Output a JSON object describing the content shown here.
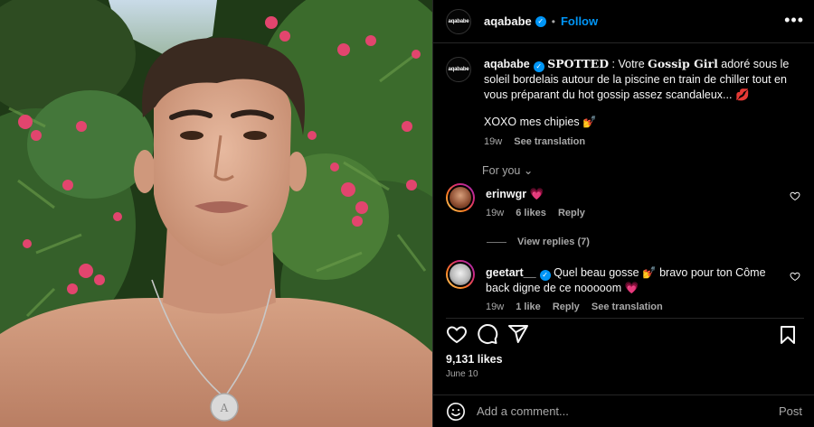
{
  "post": {
    "username": "aqababe",
    "avatar_text": "aqababe",
    "follow_label": "Follow",
    "more_label": "•••"
  },
  "caption": {
    "username": "aqababe",
    "spotted": "SPOTTED",
    "part1": " : Votre ",
    "gossip": "Gossip Girl",
    "part2": " adoré sous le soleil bordelais autour de la piscine en train de chiller tout en vous préparant du hot gossip assez scandaleux... 💋",
    "xoxo": "XOXO mes chipies 💅",
    "time": "19w",
    "see_translation": "See translation"
  },
  "for_you": "For you ⌄",
  "comments": [
    {
      "username": "erinwgr",
      "text": "💗",
      "time": "19w",
      "likes": "6 likes",
      "reply": "Reply",
      "view_replies": "View replies (7)"
    },
    {
      "username": "geetart__",
      "text": "Quel beau gosse 💅 bravo pour ton Côme back digne de ce nooooom 💗",
      "time": "19w",
      "likes": "1 like",
      "reply": "Reply",
      "see_translation": "See translation"
    }
  ],
  "stats": {
    "likes": "9,131 likes",
    "date": "June 10"
  },
  "add_comment": {
    "placeholder": "Add a comment...",
    "post_label": "Post"
  },
  "icons": {
    "like": "heart-icon",
    "comment": "comment-icon",
    "share": "share-icon",
    "save": "bookmark-icon",
    "emoji": "emoji-icon"
  }
}
